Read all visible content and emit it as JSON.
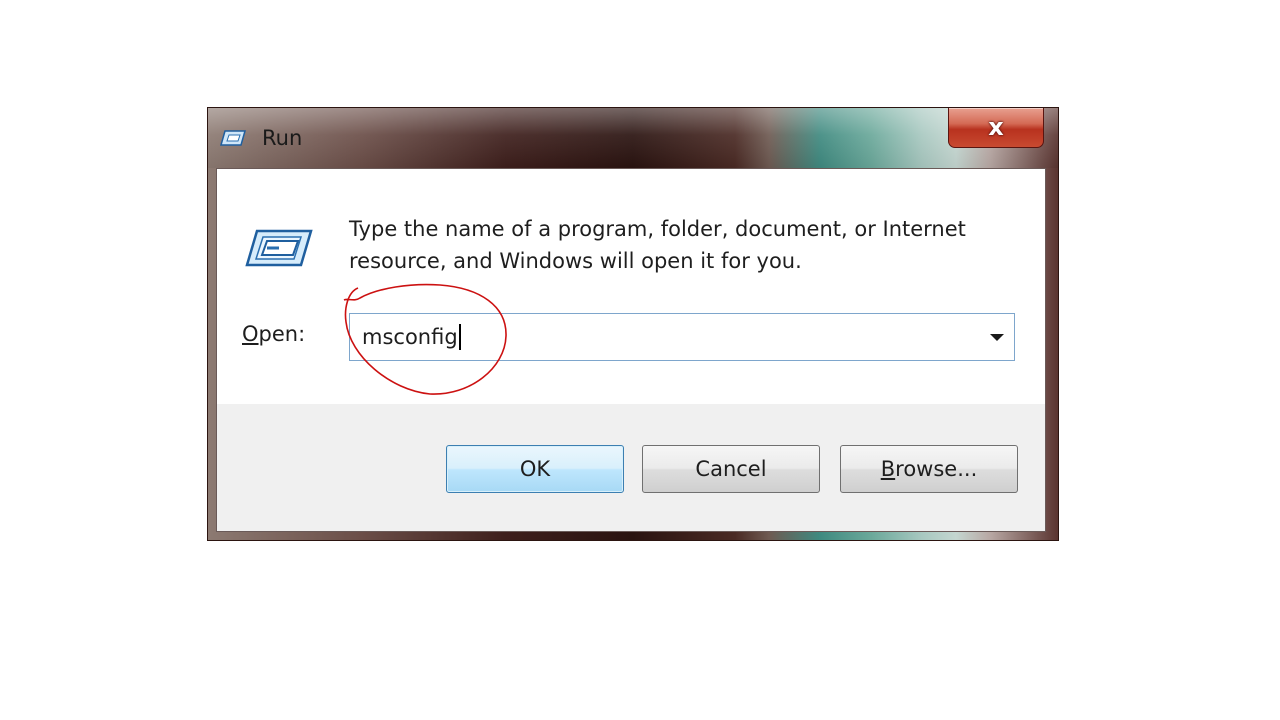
{
  "window": {
    "title": "Run",
    "close_glyph": "x",
    "icon": "run-icon"
  },
  "dialog": {
    "prompt": "Type the name of a program, folder, document, or Internet resource, and Windows will open it for you.",
    "open_label_accel": "O",
    "open_label_rest": "pen:",
    "open_value": "msconfig",
    "dropdown_icon": "chevron-down-icon"
  },
  "buttons": {
    "ok": "OK",
    "cancel": "Cancel",
    "browse_accel": "B",
    "browse_rest": "rowse..."
  },
  "colors": {
    "annotation": "#cc1111",
    "default_button_border": "#3c7fb1"
  }
}
